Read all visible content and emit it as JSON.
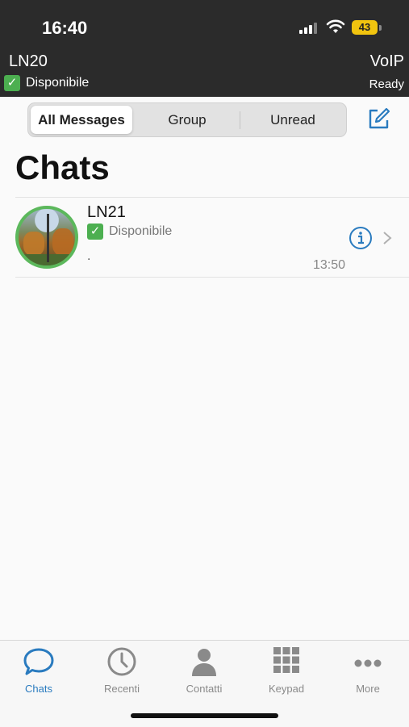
{
  "status_bar": {
    "time": "16:40",
    "battery": "43"
  },
  "account": {
    "name": "LN20",
    "status": "Disponibile",
    "service": "VoIP",
    "service_state": "Ready"
  },
  "filter_tabs": [
    {
      "label": "All Messages",
      "active": true
    },
    {
      "label": "Group",
      "active": false
    },
    {
      "label": "Unread",
      "active": false
    }
  ],
  "page_title": "Chats",
  "chats": [
    {
      "name": "LN21",
      "status": "Disponibile",
      "preview": ".",
      "time": "13:50"
    }
  ],
  "tab_bar": [
    {
      "label": "Chats",
      "icon": "chat-bubble-icon",
      "active": true
    },
    {
      "label": "Recenti",
      "icon": "clock-icon",
      "active": false
    },
    {
      "label": "Contatti",
      "icon": "person-icon",
      "active": false
    },
    {
      "label": "Keypad",
      "icon": "keypad-icon",
      "active": false
    },
    {
      "label": "More",
      "icon": "more-dots-icon",
      "active": false
    }
  ],
  "colors": {
    "accent": "#2a7bbf",
    "online": "#4caf50",
    "header_bg": "#2b2b2b",
    "battery": "#f1c40f"
  }
}
